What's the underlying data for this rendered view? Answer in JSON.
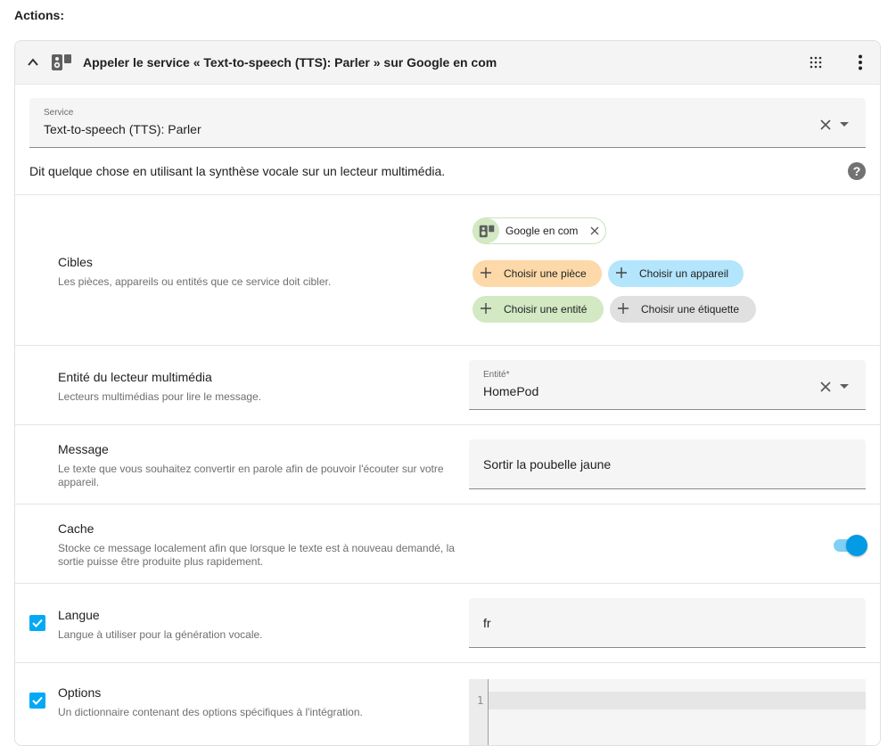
{
  "actions_label": "Actions:",
  "header": {
    "title": "Appeler le service « Text-to-speech (TTS): Parler » sur Google en com"
  },
  "service_field": {
    "label": "Service",
    "value": "Text-to-speech (TTS): Parler"
  },
  "service_description": "Dit quelque chose en utilisant la synthèse vocale sur un lecteur multimédia.",
  "help_icon": "?",
  "targets": {
    "title": "Cibles",
    "description": "Les pièces, appareils ou entités que ce service doit cibler.",
    "selected_chip": "Google en com",
    "buttons": {
      "area": "Choisir une pièce",
      "device": "Choisir un appareil",
      "entity": "Choisir une entité",
      "label": "Choisir une étiquette"
    },
    "colors": {
      "area": "#fdd9a9",
      "device": "#b3e5fc",
      "entity": "#d2e9c4",
      "label": "#e0e0e0",
      "selected_bg": "#ffffff",
      "selected_icon_bg": "#d2e9c4"
    }
  },
  "media_player": {
    "title": "Entité du lecteur multimédia",
    "description": "Lecteurs multimédias pour lire le message.",
    "field_label": "Entité*",
    "field_value": "HomePod"
  },
  "message": {
    "title": "Message",
    "description": "Le texte que vous souhaitez convertir en parole afin de pouvoir l'écouter sur votre appareil.",
    "value": "Sortir la poubelle jaune"
  },
  "cache": {
    "title": "Cache",
    "description": "Stocke ce message localement afin que lorsque le texte est à nouveau demandé, la sortie puisse être produite plus rapidement.",
    "enabled": true
  },
  "language": {
    "title": "Langue",
    "description": "Langue à utiliser pour la génération vocale.",
    "value": "fr",
    "checked": true
  },
  "options": {
    "title": "Options",
    "description": "Un dictionnaire contenant des options spécifiques à l'intégration.",
    "line_number": "1",
    "checked": true
  },
  "accent_color": "#03a9f4"
}
